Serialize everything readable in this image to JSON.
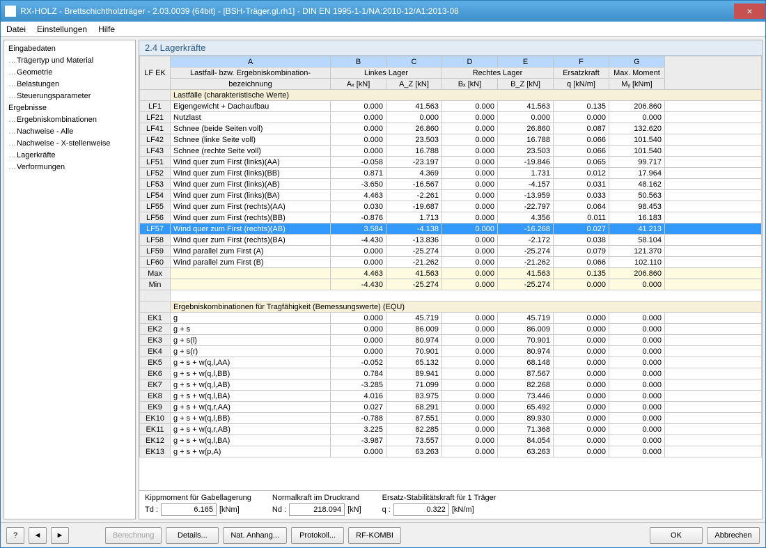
{
  "window": {
    "title": "RX-HOLZ - Brettschichtholzträger - 2.03.0039 (64bit) - [BSH-Träger.gl.rh1] - DIN EN 1995-1-1/NA:2010-12/A1:2013-08"
  },
  "menu": {
    "file": "Datei",
    "settings": "Einstellungen",
    "help": "Hilfe"
  },
  "nav": {
    "g1": "Eingabedaten",
    "i1": "Trägertyp und Material",
    "i2": "Geometrie",
    "i3": "Belastungen",
    "i4": "Steuerungsparameter",
    "g2": "Ergebnisse",
    "i5": "Ergebniskombinationen",
    "i6": "Nachweise - Alle",
    "i7": "Nachweise - X-stellenweise",
    "i8": "Lagerkräfte",
    "i9": "Verformungen"
  },
  "panel": {
    "title": "2.4 Lagerkräfte"
  },
  "grid": {
    "letters": [
      "A",
      "B",
      "C",
      "D",
      "E",
      "F",
      "G"
    ],
    "lfek": "LF EK",
    "h1": "Lastfall- bzw. Ergebniskombination-",
    "h1b": "bezeichnung",
    "g1": "Linkes Lager",
    "g2": "Rechtes Lager",
    "g3": "Ersatzkraft",
    "g4": "Max. Moment",
    "ax": "Aₓ [kN]",
    "az": "A_Z [kN]",
    "bx": "Bₓ [kN]",
    "bz": "B_Z [kN]",
    "q": "q [kN/m]",
    "my": "Mᵧ [kNm]",
    "section1": "Lastfälle (charakteristische Werte)",
    "section2": "Ergebniskombinationen für Tragfähigkeit (Bemessungswerte) (EQU)",
    "maxlbl": "Max",
    "minlbl": "Min",
    "lf": [
      {
        "id": "LF1",
        "n": "Eigengewicht + Dachaufbau",
        "v": [
          "0.000",
          "41.563",
          "0.000",
          "41.563",
          "0.135",
          "206.860"
        ]
      },
      {
        "id": "LF21",
        "n": "Nutzlast",
        "v": [
          "0.000",
          "0.000",
          "0.000",
          "0.000",
          "0.000",
          "0.000"
        ]
      },
      {
        "id": "LF41",
        "n": "Schnee (beide Seiten voll)",
        "v": [
          "0.000",
          "26.860",
          "0.000",
          "26.860",
          "0.087",
          "132.620"
        ]
      },
      {
        "id": "LF42",
        "n": "Schnee (linke Seite voll)",
        "v": [
          "0.000",
          "23.503",
          "0.000",
          "16.788",
          "0.066",
          "101.540"
        ]
      },
      {
        "id": "LF43",
        "n": "Schnee (rechte Seite voll)",
        "v": [
          "0.000",
          "16.788",
          "0.000",
          "23.503",
          "0.066",
          "101.540"
        ]
      },
      {
        "id": "LF51",
        "n": "Wind quer zum First (links)(AA)",
        "v": [
          "-0.058",
          "-23.197",
          "0.000",
          "-19.846",
          "0.065",
          "99.717"
        ]
      },
      {
        "id": "LF52",
        "n": "Wind quer zum First (links)(BB)",
        "v": [
          "0.871",
          "4.369",
          "0.000",
          "1.731",
          "0.012",
          "17.964"
        ]
      },
      {
        "id": "LF53",
        "n": "Wind quer zum First (links)(AB)",
        "v": [
          "-3.650",
          "-16.567",
          "0.000",
          "-4.157",
          "0.031",
          "48.162"
        ]
      },
      {
        "id": "LF54",
        "n": "Wind quer zum First (links)(BA)",
        "v": [
          "4.463",
          "-2.261",
          "0.000",
          "-13.959",
          "0.033",
          "50.563"
        ]
      },
      {
        "id": "LF55",
        "n": "Wind quer zum First (rechts)(AA)",
        "v": [
          "0.030",
          "-19.687",
          "0.000",
          "-22.797",
          "0.064",
          "98.453"
        ]
      },
      {
        "id": "LF56",
        "n": "Wind quer zum First (rechts)(BB)",
        "v": [
          "-0.876",
          "1.713",
          "0.000",
          "4.356",
          "0.011",
          "16.183"
        ]
      },
      {
        "id": "LF57",
        "n": "Wind quer zum First (rechts)(AB)",
        "v": [
          "3.584",
          "-4.138",
          "0.000",
          "-16.268",
          "0.027",
          "41.213"
        ],
        "sel": true
      },
      {
        "id": "LF58",
        "n": "Wind quer zum First (rechts)(BA)",
        "v": [
          "-4.430",
          "-13.836",
          "0.000",
          "-2.172",
          "0.038",
          "58.104"
        ]
      },
      {
        "id": "LF59",
        "n": "Wind parallel zum First (A)",
        "v": [
          "0.000",
          "-25.274",
          "0.000",
          "-25.274",
          "0.079",
          "121.370"
        ]
      },
      {
        "id": "LF60",
        "n": "Wind parallel zum First (B)",
        "v": [
          "0.000",
          "-21.262",
          "0.000",
          "-21.262",
          "0.066",
          "102.110"
        ]
      }
    ],
    "max": [
      "4.463",
      "41.563",
      "0.000",
      "41.563",
      "0.135",
      "206.860"
    ],
    "min": [
      "-4.430",
      "-25.274",
      "0.000",
      "-25.274",
      "0.000",
      "0.000"
    ],
    "ek": [
      {
        "id": "EK1",
        "n": "g",
        "v": [
          "0.000",
          "45.719",
          "0.000",
          "45.719",
          "0.000",
          "0.000"
        ]
      },
      {
        "id": "EK2",
        "n": "g + s",
        "v": [
          "0.000",
          "86.009",
          "0.000",
          "86.009",
          "0.000",
          "0.000"
        ]
      },
      {
        "id": "EK3",
        "n": "g + s(l)",
        "v": [
          "0.000",
          "80.974",
          "0.000",
          "70.901",
          "0.000",
          "0.000"
        ]
      },
      {
        "id": "EK4",
        "n": "g + s(r)",
        "v": [
          "0.000",
          "70.901",
          "0.000",
          "80.974",
          "0.000",
          "0.000"
        ]
      },
      {
        "id": "EK5",
        "n": "g + s + w(q,l,AA)",
        "v": [
          "-0.052",
          "65.132",
          "0.000",
          "68.148",
          "0.000",
          "0.000"
        ]
      },
      {
        "id": "EK6",
        "n": "g + s + w(q,l,BB)",
        "v": [
          "0.784",
          "89.941",
          "0.000",
          "87.567",
          "0.000",
          "0.000"
        ]
      },
      {
        "id": "EK7",
        "n": "g + s + w(q,l,AB)",
        "v": [
          "-3.285",
          "71.099",
          "0.000",
          "82.268",
          "0.000",
          "0.000"
        ]
      },
      {
        "id": "EK8",
        "n": "g + s + w(q,l,BA)",
        "v": [
          "4.016",
          "83.975",
          "0.000",
          "73.446",
          "0.000",
          "0.000"
        ]
      },
      {
        "id": "EK9",
        "n": "g + s + w(q,r,AA)",
        "v": [
          "0.027",
          "68.291",
          "0.000",
          "65.492",
          "0.000",
          "0.000"
        ]
      },
      {
        "id": "EK10",
        "n": "g + s + w(q,l,BB)",
        "v": [
          "-0.788",
          "87.551",
          "0.000",
          "89.930",
          "0.000",
          "0.000"
        ]
      },
      {
        "id": "EK11",
        "n": "g + s + w(q,r,AB)",
        "v": [
          "3.225",
          "82.285",
          "0.000",
          "71.368",
          "0.000",
          "0.000"
        ]
      },
      {
        "id": "EK12",
        "n": "g + s + w(q,l,BA)",
        "v": [
          "-3.987",
          "73.557",
          "0.000",
          "84.054",
          "0.000",
          "0.000"
        ]
      },
      {
        "id": "EK13",
        "n": "g + s + w(p,A)",
        "v": [
          "0.000",
          "63.263",
          "0.000",
          "63.263",
          "0.000",
          "0.000"
        ]
      }
    ]
  },
  "footer": {
    "l1": "Kippmoment für Gabellagerung",
    "td": "Td :",
    "tdv": "6.165",
    "tdu": "[kNm]",
    "l2": "Normalkraft im Druckrand",
    "nd": "Nd :",
    "ndv": "218.094",
    "ndu": "[kN]",
    "l3": "Ersatz-Stabilitätskraft für 1 Träger",
    "q": "q :",
    "qv": "0.322",
    "qu": "[kN/m]"
  },
  "buttons": {
    "calc": "Berechnung",
    "details": "Details...",
    "nat": "Nat. Anhang...",
    "proto": "Protokoll...",
    "rf": "RF-KOMBI",
    "ok": "OK",
    "cancel": "Abbrechen"
  }
}
